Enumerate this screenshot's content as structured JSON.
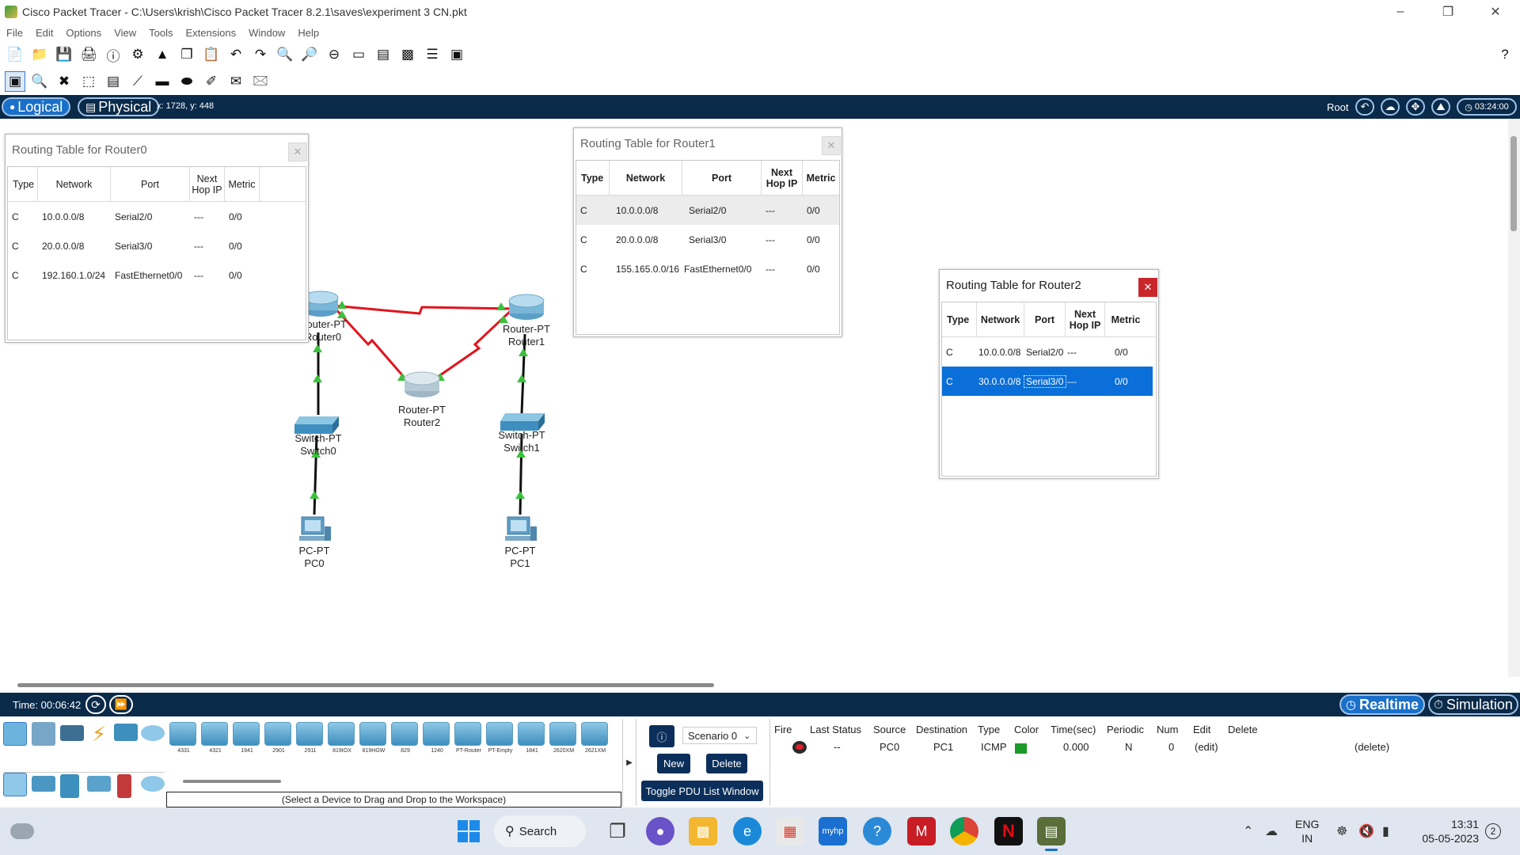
{
  "window": {
    "title": "Cisco Packet Tracer - C:\\Users\\krish\\Cisco Packet Tracer 8.2.1\\saves\\experiment 3 CN.pkt"
  },
  "menu": [
    "File",
    "Edit",
    "Options",
    "View",
    "Tools",
    "Extensions",
    "Window",
    "Help"
  ],
  "workspace_bar": {
    "logical_label": "Logical",
    "physical_label": "Physical",
    "coords": "x: 1728, y: 448",
    "root_label": "Root",
    "clock": "03:24:00"
  },
  "routing_tables": [
    {
      "title": "Routing Table for Router0",
      "headers": [
        "Type",
        "Network",
        "Port",
        "Next Hop IP",
        "Metric"
      ],
      "rows": [
        [
          "C",
          "10.0.0.0/8",
          "Serial2/0",
          "---",
          "0/0"
        ],
        [
          "C",
          "20.0.0.0/8",
          "Serial3/0",
          "---",
          "0/0"
        ],
        [
          "C",
          "192.160.1.0/24",
          "FastEthernet0/0",
          "---",
          "0/0"
        ]
      ]
    },
    {
      "title": "Routing Table for Router1",
      "headers": [
        "Type",
        "Network",
        "Port",
        "Next Hop IP",
        "Metric"
      ],
      "rows": [
        [
          "C",
          "10.0.0.0/8",
          "Serial2/0",
          "---",
          "0/0"
        ],
        [
          "C",
          "20.0.0.0/8",
          "Serial3/0",
          "---",
          "0/0"
        ],
        [
          "C",
          "155.165.0.0/16",
          "FastEthernet0/0",
          "---",
          "0/0"
        ]
      ]
    },
    {
      "title": "Routing Table for Router2",
      "headers": [
        "Type",
        "Network",
        "Port",
        "Next Hop IP",
        "Metric"
      ],
      "rows": [
        [
          "C",
          "10.0.0.0/8",
          "Serial2/0",
          "---",
          "0/0"
        ],
        [
          "C",
          "30.0.0.0/8",
          "Serial3/0",
          "---",
          "0/0"
        ]
      ]
    }
  ],
  "devices": {
    "router0": [
      "Router-PT",
      "Router0"
    ],
    "router1": [
      "Router-PT",
      "Router1"
    ],
    "router2": [
      "Router-PT",
      "Router2"
    ],
    "switch0": [
      "Switch-PT",
      "Switch0"
    ],
    "switch1": [
      "Switch-PT",
      "Switch1"
    ],
    "pc0": [
      "PC-PT",
      "PC0"
    ],
    "pc1": [
      "PC-PT",
      "PC1"
    ]
  },
  "timebar": {
    "time": "Time: 00:06:42",
    "realtime": "Realtime",
    "simulation": "Simulation"
  },
  "device_models": [
    "4331",
    "4321",
    "1941",
    "2901",
    "2911",
    "819IOX",
    "819HGW",
    "829",
    "1240",
    "PT-Router",
    "PT-Empty",
    "1841",
    "2620XM",
    "2621XM"
  ],
  "device_hint": "(Select a Device to Drag and Drop to the Workspace)",
  "scenario": {
    "selected": "Scenario 0",
    "new_label": "New",
    "delete_label": "Delete",
    "toggle_label": "Toggle PDU List Window"
  },
  "pdu_list": {
    "headers": [
      "Fire",
      "Last Status",
      "Source",
      "Destination",
      "Type",
      "Color",
      "Time(sec)",
      "Periodic",
      "Num",
      "Edit",
      "Delete"
    ],
    "row": {
      "last_status": "--",
      "source": "PC0",
      "destination": "PC1",
      "type": "ICMP",
      "color": "#1a9a28",
      "time": "0.000",
      "periodic": "N",
      "num": "0",
      "edit": "(edit)",
      "delete": "(delete)"
    }
  },
  "taskbar": {
    "search_label": "Search",
    "lang": [
      "ENG",
      "IN"
    ],
    "time": "13:31",
    "date": "05-05-2023",
    "notifications": "2"
  },
  "colors": {
    "workspace_bar": "#0a2a4a",
    "serial_link": "#e0141e",
    "selection": "#0a6fd8"
  }
}
